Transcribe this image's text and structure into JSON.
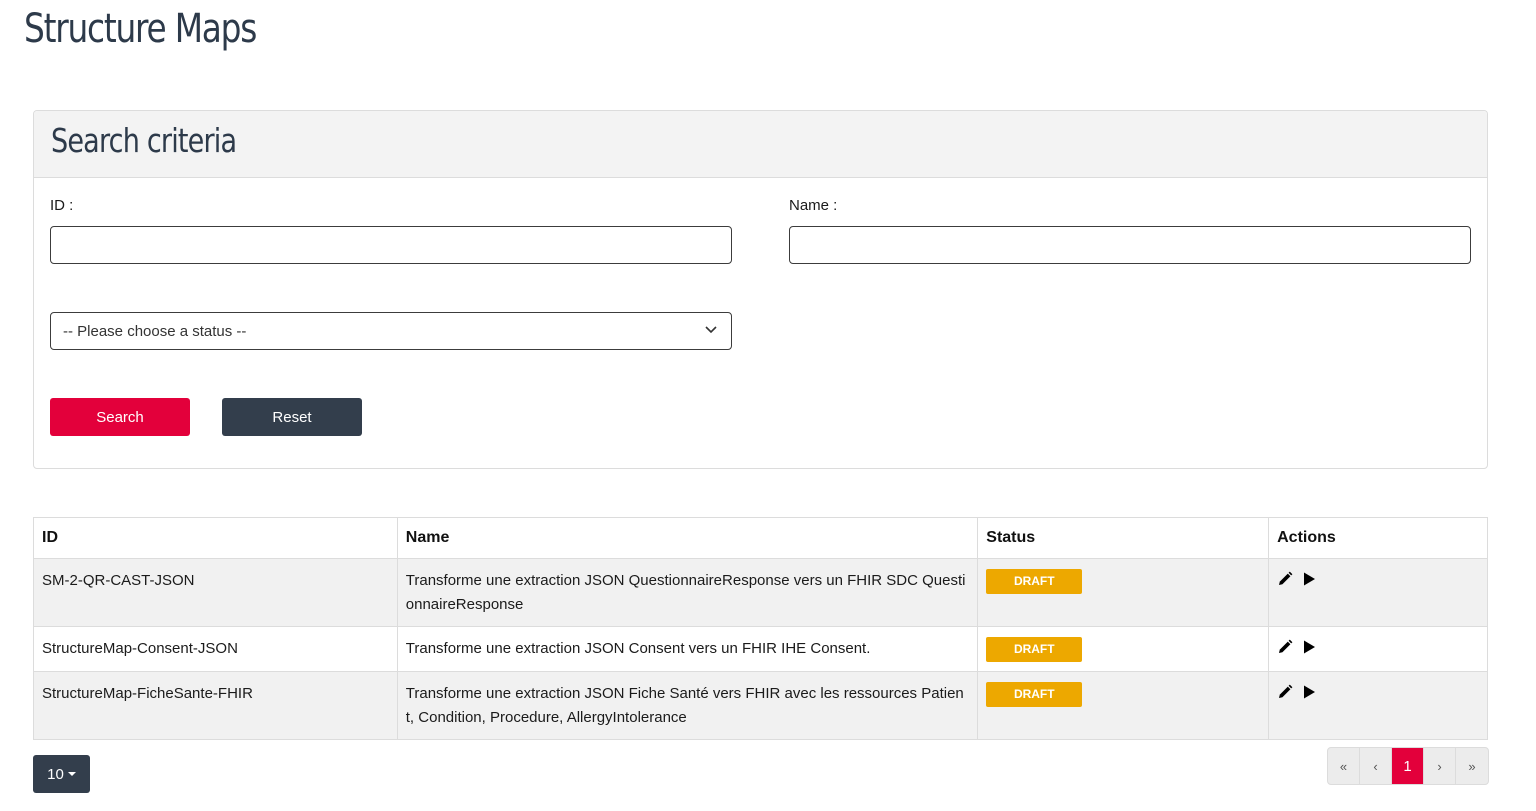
{
  "page": {
    "title": "Structure Maps"
  },
  "search": {
    "title": "Search criteria",
    "id_label": "ID :",
    "id_value": "",
    "name_label": "Name :",
    "name_value": "",
    "status_select": "-- Please choose a status --",
    "search_button": "Search",
    "reset_button": "Reset"
  },
  "table": {
    "headers": [
      "ID",
      "Name",
      "Status",
      "Actions"
    ],
    "rows": [
      {
        "id": "SM-2-QR-CAST-JSON",
        "name": "Transforme une extraction JSON QuestionnaireResponse vers un FHIR SDC QuestionnaireResponse",
        "status": "DRAFT"
      },
      {
        "id": "StructureMap-Consent-JSON",
        "name": "Transforme une extraction JSON Consent vers un FHIR IHE Consent.",
        "status": "DRAFT"
      },
      {
        "id": "StructureMap-FicheSante-FHIR",
        "name": "Transforme une extraction JSON Fiche Santé vers FHIR avec les ressources Patient, Condition, Procedure, AllergyIntolerance",
        "status": "DRAFT"
      }
    ],
    "action_icons": [
      "pencil-icon",
      "play-icon"
    ]
  },
  "footer": {
    "page_size": "10",
    "pagination": {
      "first": "«",
      "prev": "‹",
      "current": "1",
      "next": "›",
      "last": "»"
    }
  },
  "colors": {
    "primary": "#e3003b",
    "dark": "#333e4c",
    "badge": "#eda800"
  }
}
